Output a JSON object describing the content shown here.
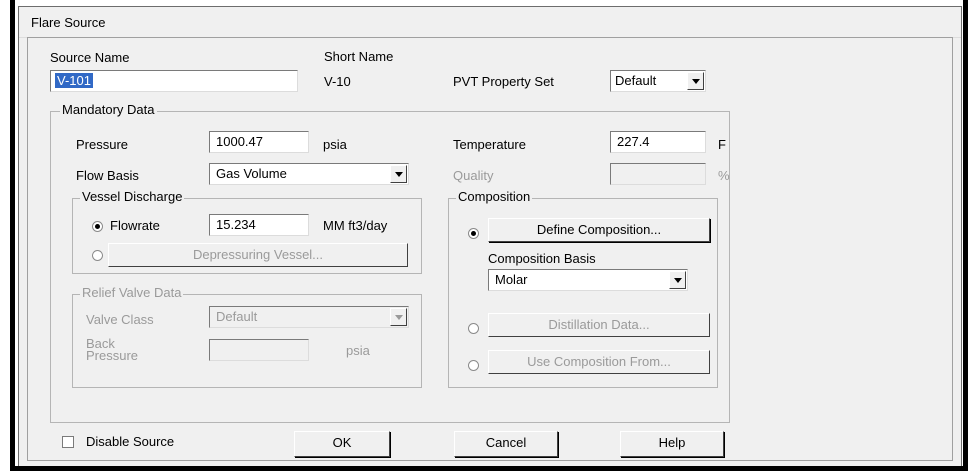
{
  "window": {
    "title": "Flare Source"
  },
  "source": {
    "source_name_label": "Source Name",
    "source_name_value": "V-101",
    "short_name_label": "Short Name",
    "short_name_value": "V-10",
    "pvt_label": "PVT Property Set",
    "pvt_value": "Default"
  },
  "mandatory": {
    "title": "Mandatory Data",
    "pressure_label": "Pressure",
    "pressure_value": "1000.47",
    "pressure_unit": "psia",
    "temperature_label": "Temperature",
    "temperature_value": "227.4",
    "temperature_unit": "F",
    "flow_basis_label": "Flow Basis",
    "flow_basis_value": "Gas Volume",
    "quality_label": "Quality",
    "quality_value": "",
    "quality_unit": "%"
  },
  "vessel": {
    "title": "Vessel Discharge",
    "flowrate_label": "Flowrate",
    "flowrate_value": "15.234",
    "flowrate_unit": "MM ft3/day",
    "depressuring_label": "Depressuring Vessel..."
  },
  "relief": {
    "title": "Relief Valve Data",
    "valve_class_label": "Valve Class",
    "valve_class_value": "Default",
    "back_label_1": "Back",
    "back_label_2": "Pressure",
    "back_value": "",
    "back_unit": "psia"
  },
  "composition": {
    "title": "Composition",
    "define_label": "Define Composition...",
    "basis_label": "Composition Basis",
    "basis_value": "Molar",
    "distillation_label": "Distillation Data...",
    "use_from_label": "Use Composition From..."
  },
  "footer": {
    "disable_label": "Disable Source",
    "ok_label": "OK",
    "cancel_label": "Cancel",
    "help_label": "Help"
  }
}
